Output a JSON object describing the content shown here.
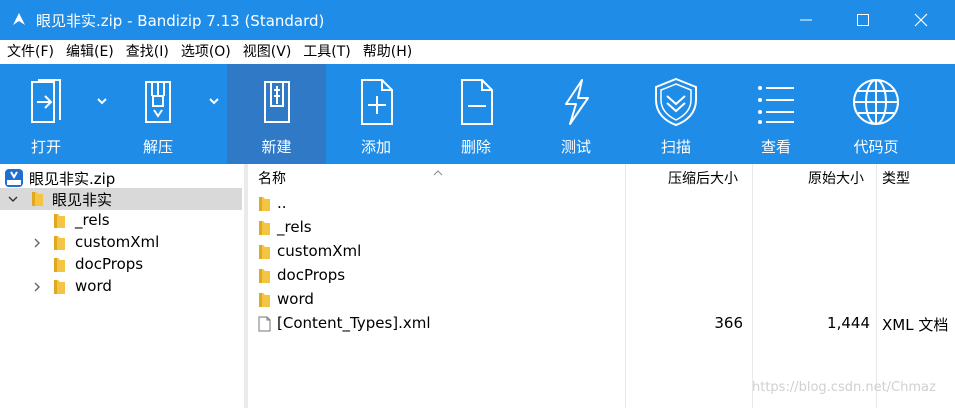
{
  "window": {
    "title": "眼见非实.zip - Bandizip 7.13 (Standard)"
  },
  "menu": [
    "文件(F)",
    "编辑(E)",
    "查找(I)",
    "选项(O)",
    "视图(V)",
    "工具(T)",
    "帮助(H)"
  ],
  "toolbar": {
    "open": "打开",
    "extract": "解压",
    "new": "新建",
    "add": "添加",
    "delete": "删除",
    "test": "测试",
    "scan": "扫描",
    "view": "查看",
    "codepage": "代码页"
  },
  "tree": {
    "root": "眼见非实.zip",
    "folder": "眼见非实",
    "children": [
      "_rels",
      "customXml",
      "docProps",
      "word"
    ]
  },
  "list": {
    "headers": {
      "name": "名称",
      "compressed": "压缩后大小",
      "original": "原始大小",
      "type": "类型"
    },
    "rows": [
      {
        "name": "..",
        "compressed": "",
        "original": "",
        "type": ""
      },
      {
        "name": "_rels",
        "compressed": "",
        "original": "",
        "type": ""
      },
      {
        "name": "customXml",
        "compressed": "",
        "original": "",
        "type": ""
      },
      {
        "name": "docProps",
        "compressed": "",
        "original": "",
        "type": ""
      },
      {
        "name": "word",
        "compressed": "",
        "original": "",
        "type": ""
      },
      {
        "name": "[Content_Types].xml",
        "compressed": "366",
        "original": "1,444",
        "type": "XML 文档"
      }
    ]
  },
  "watermark": "https://blog.csdn.net/Chmaz",
  "colors": {
    "accent": "#1f8ce8",
    "toolbar_active": "#2f79c6",
    "folder": "#f4c542"
  }
}
